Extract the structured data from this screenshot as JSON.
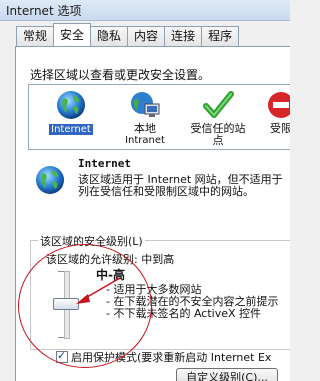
{
  "window": {
    "title": "Internet 选项"
  },
  "tabs": [
    {
      "label": "常规"
    },
    {
      "label": "安全",
      "active": true
    },
    {
      "label": "隐私"
    },
    {
      "label": "内容"
    },
    {
      "label": "连接"
    },
    {
      "label": "程序"
    }
  ],
  "security": {
    "zone_instruction": "选择区域以查看或更改安全设置。",
    "zones": [
      {
        "label": "Internet",
        "icon": "globe-icon",
        "selected": true
      },
      {
        "label_line1": "本地",
        "label_line2": "Intranet",
        "icon": "intranet-icon"
      },
      {
        "label_line1": "受信任的站",
        "label_line2": "点",
        "icon": "checkmark-icon"
      },
      {
        "label_line1": "受限",
        "icon": "restricted-icon"
      }
    ],
    "selected_zone": {
      "name": "Internet",
      "description": "该区域适用于 Internet 网站，但不适用于列在受信任和受限制区域中的网站。"
    },
    "level_group": {
      "title": "该区域的安全级别(L)",
      "allowed": "该区域的允许级别: 中到高",
      "level_name": "中-高",
      "bullets": [
        "- 适用于大多数网站",
        "- 在下载潜在的不安全内容之前提示",
        "- 不下载未签名的 ActiveX 控件"
      ],
      "slider_level_fraction": 0.5
    },
    "protected_mode": {
      "label": "启用保护模式(要求重新启动 Internet Ex",
      "checked": true
    },
    "custom_level_button": "自定义级别(C)..."
  },
  "colors": {
    "annotation": "#c8141d",
    "selection": "#3165c4"
  }
}
